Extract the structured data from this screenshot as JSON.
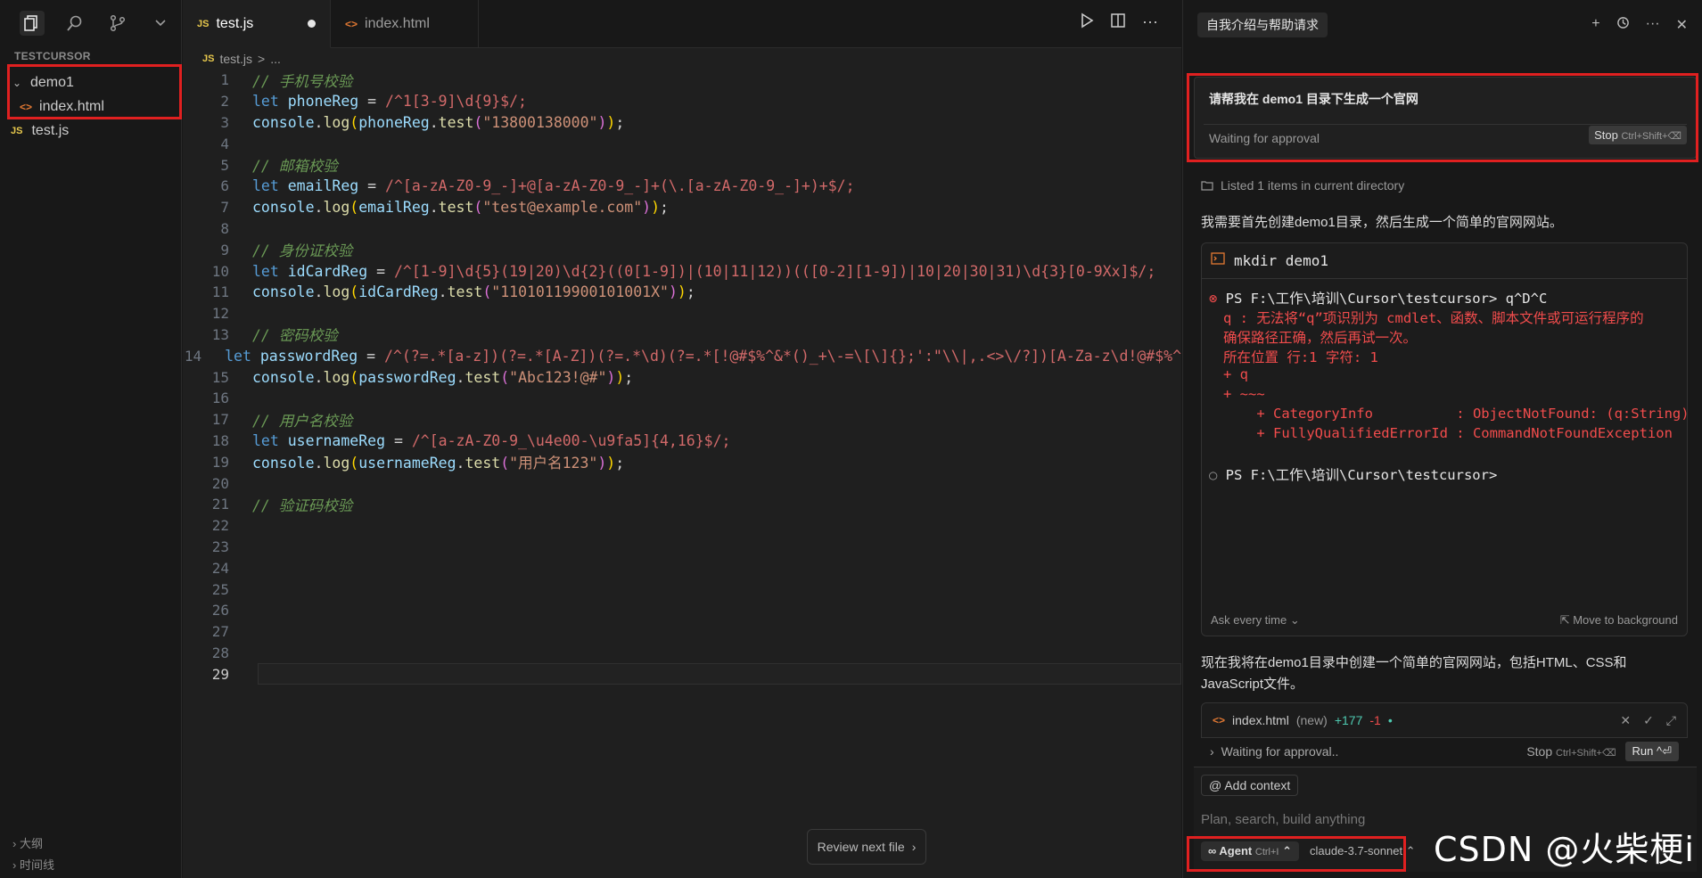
{
  "sidebar": {
    "explorer_title": "TESTCURSOR",
    "folder": "demo1",
    "folder_file": "index.html",
    "root_file": "test.js",
    "outline": "大纲",
    "timeline": "时间线"
  },
  "editor": {
    "tabs": [
      {
        "label": "test.js",
        "badge": "JS"
      },
      {
        "label": "index.html",
        "badge": "<>"
      }
    ],
    "breadcrumb": {
      "file": "test.js",
      "sep": ">",
      "rest": "..."
    },
    "review_label": "Review next file"
  },
  "code_lines": [
    "// 手机号校验",
    "let phoneReg = /^1[3-9]\\d{9}$/;",
    "console.log(phoneReg.test(\"13800138000\"));",
    "",
    "// 邮箱校验",
    "let emailReg = /^[a-zA-Z0-9_-]+@[a-zA-Z0-9_-]+(\\.[a-zA-Z0-9_-]+)+$/;",
    "console.log(emailReg.test(\"test@example.com\"));",
    "",
    "// 身份证校验",
    "let idCardReg = /^[1-9]\\d{5}(19|20)\\d{2}((0[1-9])|(10|11|12))(([0-2][1-9])|10|20|30|31)\\d{3}[0-9Xx]$/;",
    "console.log(idCardReg.test(\"11010119900101001X\"));",
    "",
    "// 密码校验",
    "let passwordReg = /^(?=.*[a-z])(?=.*[A-Z])(?=.*\\d)(?=.*[!@#$%^&*()_+\\-=\\[\\]{};':\"\\\\|,.<>\\/?])[A-Za-z\\d!@#$%^",
    "console.log(passwordReg.test(\"Abc123!@#\"));",
    "",
    "// 用户名校验",
    "let usernameReg = /^[a-zA-Z0-9_\\u4e00-\\u9fa5]{4,16}$/;",
    "console.log(usernameReg.test(\"用户名123\"));",
    "",
    "// 验证码校验",
    "",
    "",
    "",
    "",
    "",
    "",
    "",
    ""
  ],
  "chat": {
    "title": "自我介绍与帮助请求",
    "request": "请帮我在 demo1 目录下生成一个官网",
    "waiting": "Waiting for approval",
    "stop_label": "Stop",
    "stop_shortcut": "Ctrl+Shift+⌫",
    "listed": "Listed 1 items in current directory",
    "msg1": "我需要首先创建demo1目录，然后生成一个简单的官网网站。",
    "terminal": {
      "command": "mkdir demo1",
      "prompt1": "PS F:\\工作\\培训\\Cursor\\testcursor> ",
      "input1": "q^D^C",
      "err1": "q : 无法将“q”项识别为 cmdlet、函数、脚本文件或可运行程序的",
      "err2": "确保路径正确，然后再试一次。",
      "err3": "所在位置 行:1 字符: 1",
      "err4": "+ q",
      "err5": "+ ~~~",
      "err6": "    + CategoryInfo          : ObjectNotFound: (q:String)",
      "err7": "    + FullyQualifiedErrorId : CommandNotFoundException",
      "prompt2": "PS F:\\工作\\培训\\Cursor\\testcursor>",
      "ask": "Ask every time",
      "move_bg": "Move to background"
    },
    "msg2a": "现在我将在demo1目录中创建一个简单的官网网站，包括HTML、CSS和",
    "msg2b": "JavaScript文件。",
    "diff": {
      "file": "index.html",
      "tag": "(new)",
      "added": "+177",
      "removed": "-1"
    },
    "wait_row": {
      "label": "Waiting for approval..",
      "stop": "Stop",
      "stop_shortcut": "Ctrl+Shift+⌫",
      "run": "Run ^⏎"
    },
    "add_context": "Add context",
    "placeholder": "Plan, search, build anything",
    "agent_label": "Agent",
    "agent_shortcut": "Ctrl+I",
    "model": "claude-3.7-sonnet"
  },
  "watermark": "CSDN @火柴梗i"
}
